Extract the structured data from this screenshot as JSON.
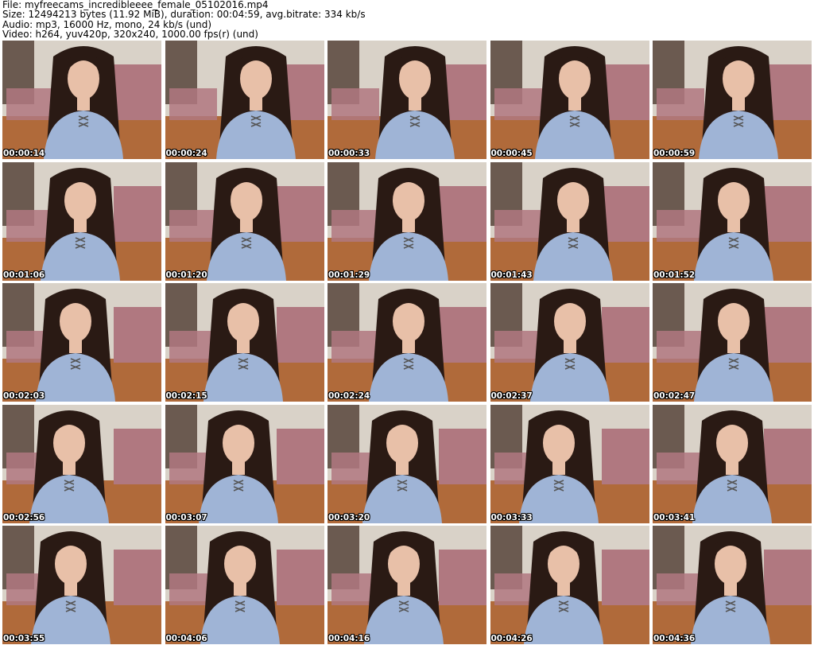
{
  "header": {
    "file_line": "File: myfreecams_incredibleeee_female_05102016.mp4",
    "size_line": "Size: 12494213 bytes (11.92 MiB), duration: 00:04:59, avg.bitrate: 334 kb/s",
    "audio_line": "Audio: mp3, 16000 Hz, mono, 24 kb/s (und)",
    "video_line": "Video: h264, yuv420p, 320x240, 1000.00 fps(r) (und)"
  },
  "thumbnails": [
    {
      "timestamp": "00:00:14"
    },
    {
      "timestamp": "00:00:24"
    },
    {
      "timestamp": "00:00:33"
    },
    {
      "timestamp": "00:00:45"
    },
    {
      "timestamp": "00:00:59"
    },
    {
      "timestamp": "00:01:06"
    },
    {
      "timestamp": "00:01:20"
    },
    {
      "timestamp": "00:01:29"
    },
    {
      "timestamp": "00:01:43"
    },
    {
      "timestamp": "00:01:52"
    },
    {
      "timestamp": "00:02:03"
    },
    {
      "timestamp": "00:02:15"
    },
    {
      "timestamp": "00:02:24"
    },
    {
      "timestamp": "00:02:37"
    },
    {
      "timestamp": "00:02:47"
    },
    {
      "timestamp": "00:02:56"
    },
    {
      "timestamp": "00:03:07"
    },
    {
      "timestamp": "00:03:20"
    },
    {
      "timestamp": "00:03:33"
    },
    {
      "timestamp": "00:03:41"
    },
    {
      "timestamp": "00:03:55"
    },
    {
      "timestamp": "00:04:06"
    },
    {
      "timestamp": "00:04:16"
    },
    {
      "timestamp": "00:04:26"
    },
    {
      "timestamp": "00:04:36"
    }
  ],
  "colors": {
    "wall": "#d9d2c8",
    "floor": "#b06a3a",
    "bedding": "#b07880",
    "top": "#9fb4d6",
    "hair": "#2a1a14",
    "skin": "#e8c0a8",
    "timestamp_text": "#ffffff",
    "timestamp_outline": "#000000"
  }
}
